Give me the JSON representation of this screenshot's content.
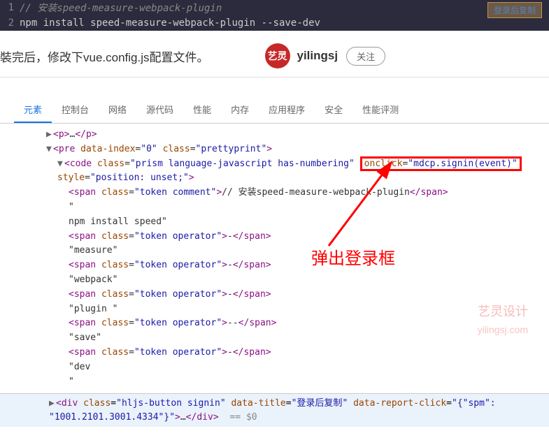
{
  "editor": {
    "line1_num": "1",
    "line1_comment": "// 安装speed-measure-webpack-plugin",
    "line2_num": "2",
    "line2_cmd": "npm install speed",
    "line2_dash1": "-",
    "line2_p1": "measure",
    "line2_dash2": "-",
    "line2_p2": "webpack",
    "line2_dash3": "-",
    "line2_p3": "plugin ",
    "line2_dash4": "--",
    "line2_p4": "save",
    "line2_dash5": "-",
    "line2_p5": "dev",
    "copy_btn": "登录后复制"
  },
  "article": {
    "text": "裝完后，修改下vue.config.js配置文件。",
    "avatar_text": "艺灵",
    "author_name": "yilingsj",
    "follow_btn": "关注"
  },
  "tabs": {
    "elements": "元素",
    "console": "控制台",
    "network": "网络",
    "sources": "源代码",
    "performance": "性能",
    "memory": "内存",
    "application": "应用程序",
    "security": "安全",
    "lighthouse": "性能评测"
  },
  "elements": {
    "p_open": "<p>",
    "p_dots": "…",
    "p_close": "</p>",
    "pre_tag": "pre",
    "pre_attr1_name": "data-index",
    "pre_attr1_val": "0",
    "pre_attr2_name": "class",
    "pre_attr2_val": "prettyprint",
    "code_tag": "code",
    "code_attr1_name": "class",
    "code_attr1_val": "prism language-javascript has-numbering",
    "code_attr2_name": "onclick",
    "code_attr2_val": "mdcp.signin(event)",
    "code_style_name": "style",
    "code_style_val": "position: unset;",
    "span_tag": "span",
    "span_class_name": "class",
    "comment_class": "token comment",
    "comment_text": "// 安装speed-measure-webpack-plugin",
    "quote_only": "\"",
    "npm_text": "npm install speed\"",
    "operator_class": "token operator",
    "dash": "-",
    "measure_text": "\"measure\"",
    "webpack_text": "\"webpack\"",
    "plugin_text": "\"plugin \"",
    "double_dash": "--",
    "save_text": "\"save\"",
    "dev_text": "\"dev",
    "div_tag": "div",
    "div_class_val": "hljs-button signin",
    "div_attr2_name": "data-title",
    "div_attr2_val": "登录后复制",
    "div_attr3_name": "data-report-click",
    "div_attr3_val_part1": "{\"spm\":",
    "div_attr3_val_part2": "\"1001.2101.3001.4334\"}",
    "div_dots": "…",
    "div_close": "</div>",
    "eq_dollar": " == $0"
  },
  "annotation": {
    "popup_login": "弹出登录框"
  },
  "watermark": {
    "line1": "艺灵设计",
    "line2": "yilingsj.com"
  }
}
